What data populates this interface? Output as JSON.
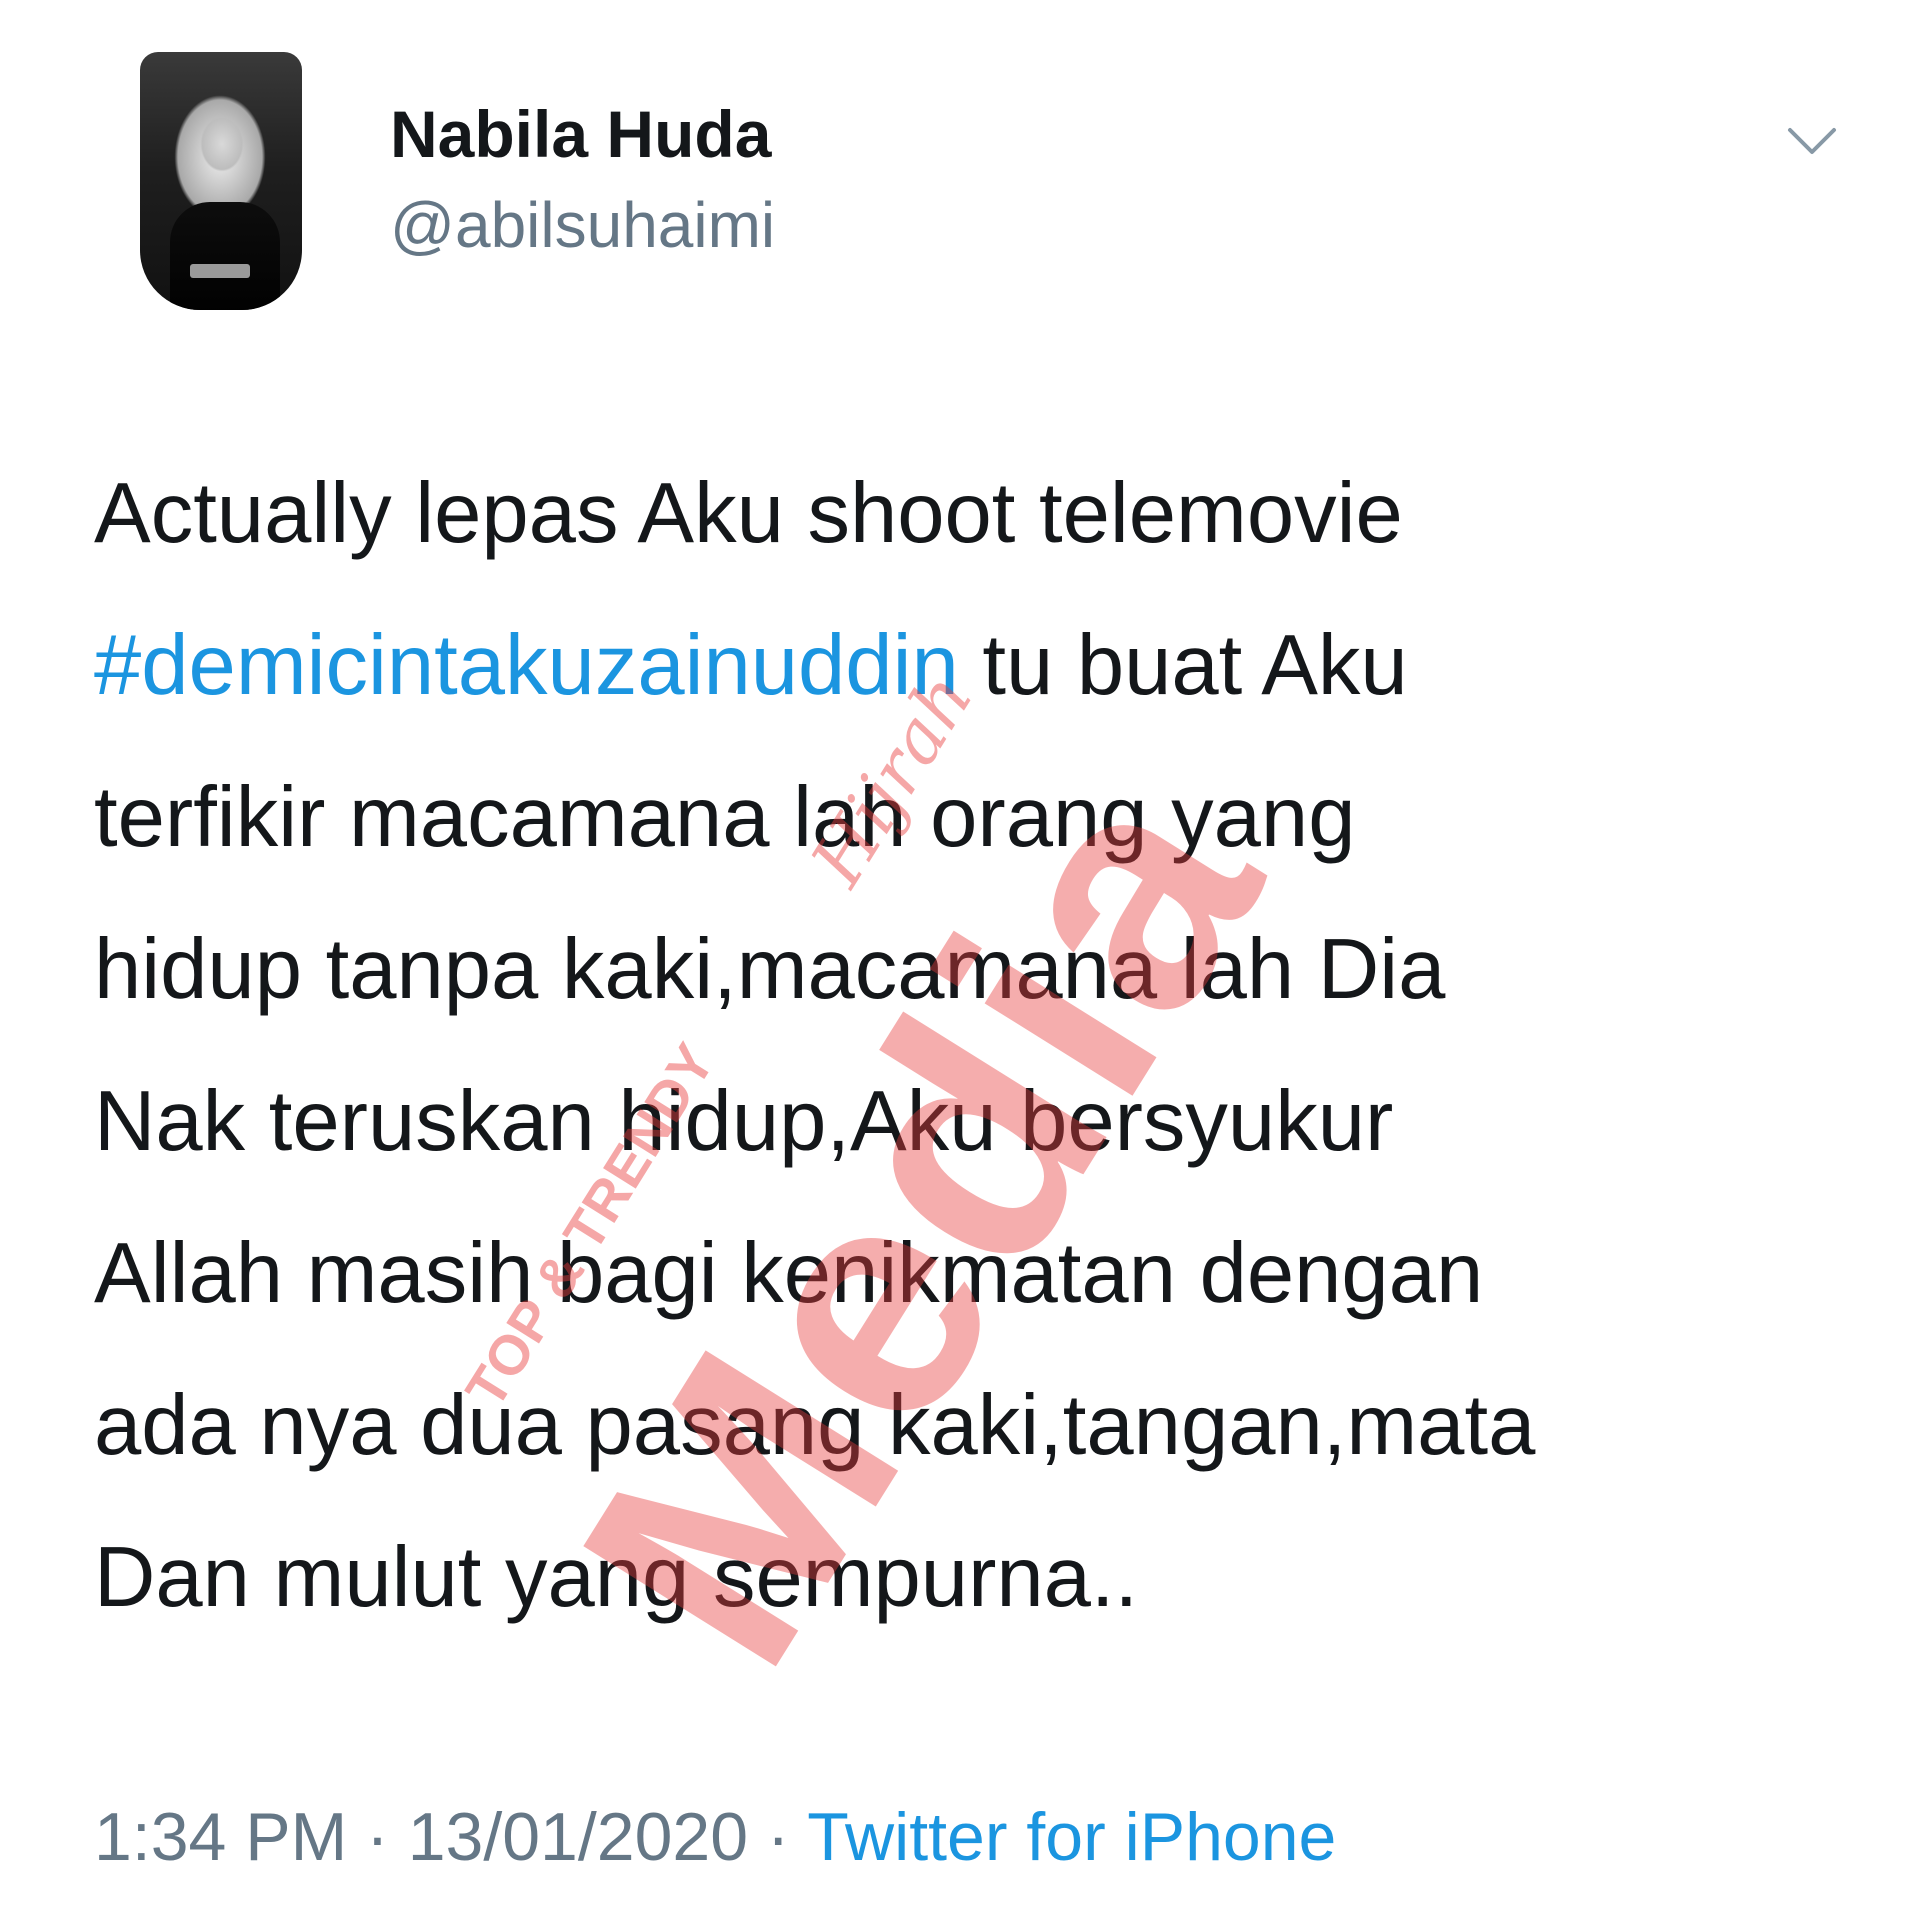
{
  "user": {
    "display_name": "Nabila Huda",
    "handle": "@abilsuhaimi"
  },
  "tweet": {
    "lines": [
      {
        "text": "Actually lepas Aku shoot telemovie"
      },
      {
        "hashtag": "#demicintakuzainuddin",
        "text": " tu buat Aku"
      },
      {
        "text": "terfikir macamana lah orang yang"
      },
      {
        "text": "hidup tanpa kaki,macamana lah Dia"
      },
      {
        "text": "Nak teruskan hidup,Aku bersyukur"
      },
      {
        "text": "Allah masih bagi kenikmatan dengan"
      },
      {
        "text": "ada nya dua pasang kaki,tangan,mata"
      },
      {
        "text": "Dan mulut yang sempurna.."
      }
    ]
  },
  "meta": {
    "time": "1:34 PM",
    "separator": " · ",
    "date": "13/01/2020",
    "source": "Twitter for iPhone"
  },
  "watermark": {
    "main": "Media",
    "top": "TOP & TRENDY",
    "script": "Hijrah"
  },
  "icons": {
    "caret": "chevron-down-icon",
    "avatar": "profile-photo"
  },
  "colors": {
    "text": "#14171a",
    "secondary": "#657786",
    "link": "#1b95e0",
    "watermark": "#e83c3c"
  }
}
